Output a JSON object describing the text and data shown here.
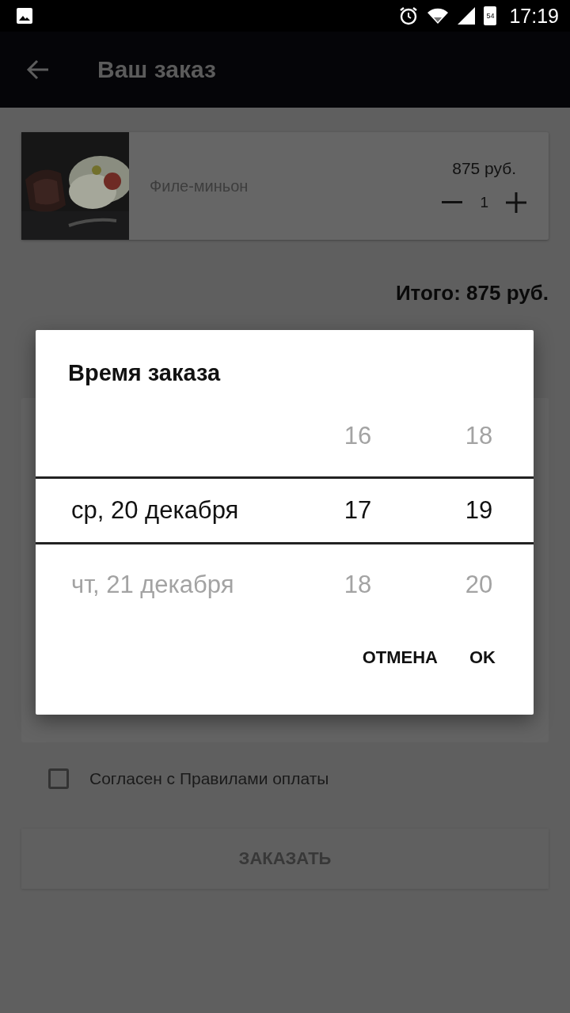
{
  "status_bar": {
    "time": "17:19",
    "battery": "54"
  },
  "app_bar": {
    "title": "Ваш заказ"
  },
  "order_items": [
    {
      "name": "Филе-миньон",
      "price": "875 руб.",
      "quantity": "1"
    }
  ],
  "total": "Итого: 875 руб.",
  "agreement": {
    "label": "Согласен с Правилами оплаты",
    "checked": false
  },
  "order_button": {
    "label": "ЗАКАЗАТЬ",
    "disabled": true
  },
  "dialog": {
    "title": "Время заказа",
    "rows": [
      {
        "hour": "16",
        "minute": "18",
        "selected": false
      },
      {
        "date": "ср, 20 декабря",
        "hour": "17",
        "minute": "19",
        "selected": true
      },
      {
        "date": "чт, 21 декабря",
        "hour": "18",
        "minute": "20",
        "selected": false
      }
    ],
    "buttons": [
      "ОТМЕНА",
      "OK"
    ]
  }
}
